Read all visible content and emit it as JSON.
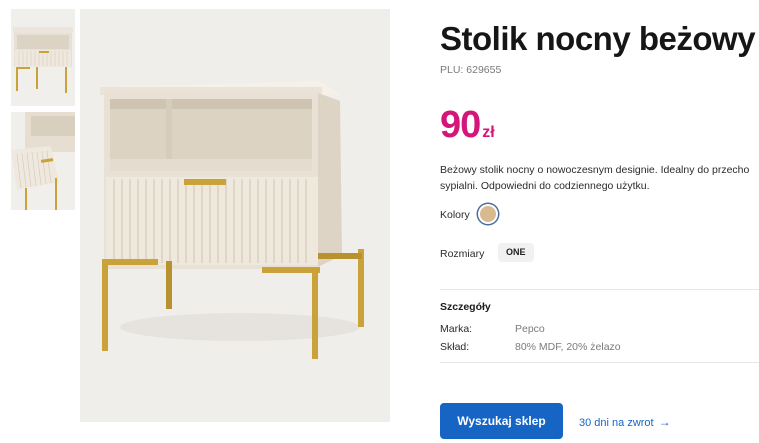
{
  "product": {
    "title": "Stolik nocny beżowy",
    "plu": "PLU: 629655",
    "price_value": "90",
    "price_currency": "zł",
    "description_line1": "Beżowy stolik nocny o nowoczesnym designie. Idealny do przecho",
    "description_line2": "sypialni. Odpowiedni do codziennego użytku.",
    "colors_label": "Kolory",
    "color_swatch_hex": "#d9b98e",
    "sizes_label": "Rozmiary",
    "size_value": "ONE"
  },
  "details": {
    "heading": "Szczegóły",
    "rows": [
      {
        "key": "Marka:",
        "value": "Pepco"
      },
      {
        "key": "Skład:",
        "value": "80% MDF, 20% żelazo"
      }
    ]
  },
  "actions": {
    "find_store": "Wyszukaj sklep",
    "returns_link": "30 dni na zwrot",
    "returns_icon": "arrow-right-icon"
  },
  "colors": {
    "accent": "#d4157a",
    "button": "#1665c5",
    "furniture": "#ece4d8",
    "gold": "#c9a23a"
  }
}
